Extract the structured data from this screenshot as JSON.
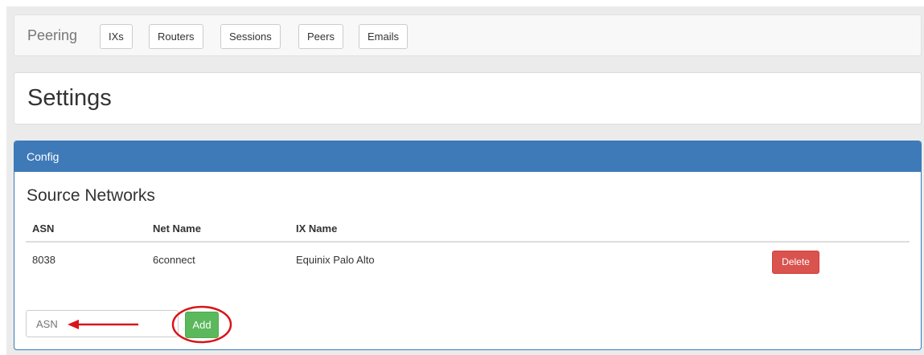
{
  "nav": {
    "brand": "Peering",
    "items": [
      {
        "label": "IXs"
      },
      {
        "label": "Routers"
      },
      {
        "label": "Sessions"
      },
      {
        "label": "Peers"
      },
      {
        "label": "Emails"
      }
    ]
  },
  "page": {
    "title": "Settings"
  },
  "panel": {
    "heading": "Config",
    "section_title": "Source Networks",
    "columns": [
      "ASN",
      "Net Name",
      "IX Name"
    ],
    "rows": [
      {
        "asn": "8038",
        "net_name": "6connect",
        "ix_name": "Equinix Palo Alto",
        "action": "Delete"
      }
    ],
    "input_placeholder": "ASN",
    "add_label": "Add"
  },
  "annotation": {
    "color": "#d9141b"
  }
}
